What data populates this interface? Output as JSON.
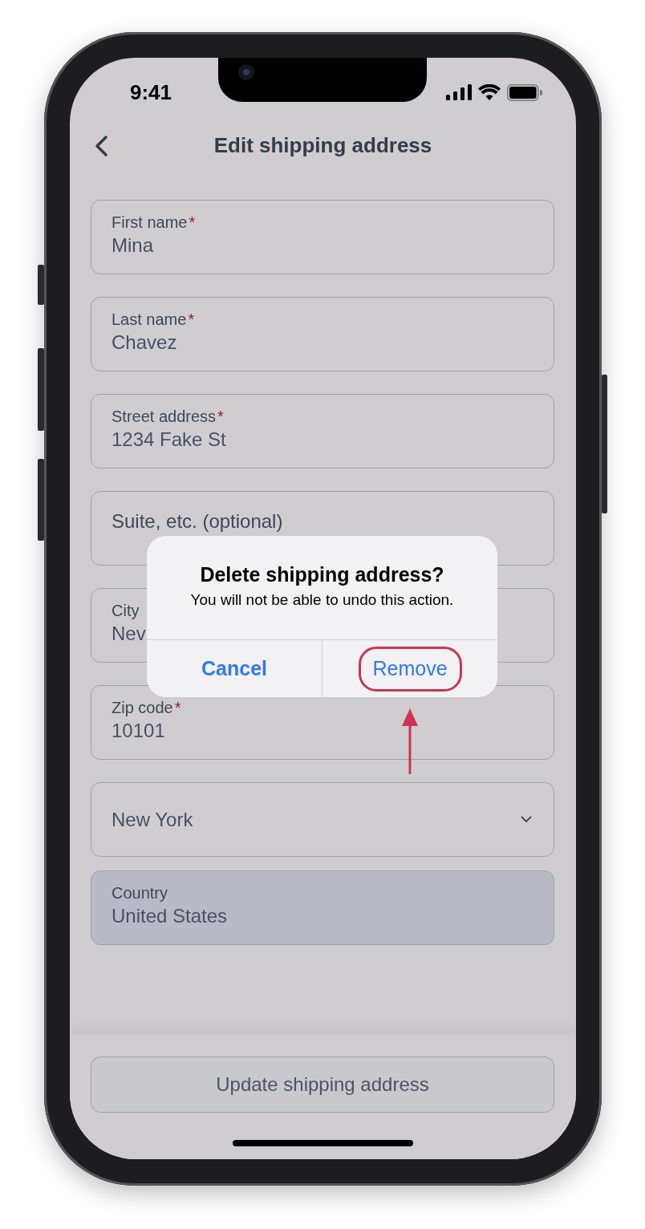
{
  "status_bar": {
    "time": "9:41"
  },
  "header": {
    "title": "Edit shipping address"
  },
  "fields": [
    {
      "kind": "text",
      "label": "First name",
      "required_mark": "*",
      "value": "Mina",
      "disabled": false
    },
    {
      "kind": "text",
      "label": "Last name",
      "required_mark": "*",
      "value": "Chavez",
      "disabled": false
    },
    {
      "kind": "text",
      "label": "Street address",
      "required_mark": "*",
      "value": "1234 Fake St",
      "disabled": false
    },
    {
      "kind": "empty",
      "placeholder": "Suite, etc. (optional)",
      "disabled": false
    },
    {
      "kind": "text",
      "label": "City",
      "value": "Nev",
      "disabled": false
    },
    {
      "kind": "text",
      "label": "Zip code",
      "required_mark": "*",
      "value": "10101",
      "disabled": false
    },
    {
      "kind": "select",
      "value": "New York",
      "disabled": false
    },
    {
      "kind": "text",
      "label": "Country",
      "value": "United States",
      "disabled": true
    }
  ],
  "submit_button": {
    "label": "Update shipping address"
  },
  "dialog": {
    "title": "Delete shipping address?",
    "message": "You will not be able to undo this action.",
    "actions": [
      {
        "label": "Cancel",
        "kind": "cancel",
        "highlighted": false
      },
      {
        "label": "Remove",
        "kind": "default",
        "highlighted": true
      }
    ]
  }
}
